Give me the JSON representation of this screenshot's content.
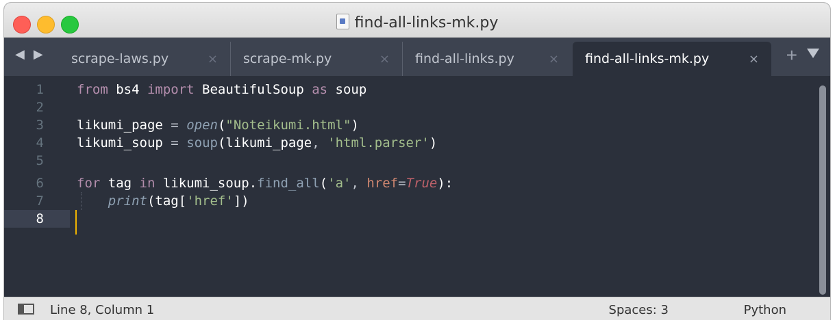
{
  "window": {
    "title": "find-all-links-mk.py"
  },
  "tabs": [
    {
      "label": "scrape-laws.py",
      "close": "×",
      "active": false
    },
    {
      "label": "scrape-mk.py",
      "close": "×",
      "active": false
    },
    {
      "label": "find-all-links.py",
      "close": "×",
      "active": false
    },
    {
      "label": "find-all-links-mk.py",
      "close": "×",
      "active": true
    }
  ],
  "tabbar": {
    "nav_arrows": "◀ ▶",
    "new_tab": "+"
  },
  "editor": {
    "line_numbers": [
      "1",
      "2",
      "3",
      "4",
      "5",
      "6",
      "7",
      "8"
    ],
    "current_line": "8",
    "lines": {
      "l1": {
        "t1": "from",
        "t2": " bs4 ",
        "t3": "import",
        "t4": " BeautifulSoup ",
        "t5": "as",
        "t6": " soup"
      },
      "l3": {
        "t1": "likumi_page ",
        "t2": "=",
        "t3": " ",
        "t4": "open",
        "t5": "(",
        "t6": "\"Noteikumi.html\"",
        "t7": ")"
      },
      "l4": {
        "t1": "likumi_soup ",
        "t2": "=",
        "t3": " ",
        "t4": "soup",
        "t5": "(likumi_page",
        "t6": ",",
        "t7": " ",
        "t8": "'html.parser'",
        "t9": ")"
      },
      "l6": {
        "t1": "for",
        "t2": " tag ",
        "t3": "in",
        "t4": " likumi_soup",
        "t5": ".",
        "t6": "find_all",
        "t7": "(",
        "t8": "'a'",
        "t9": ",",
        "t10": " ",
        "t11": "href",
        "t12": "=",
        "t13": "True",
        "t14": "):"
      },
      "l7": {
        "t0": "    ",
        "t1": "print",
        "t2": "(tag[",
        "t3": "'href'",
        "t4": "])"
      }
    }
  },
  "statusbar": {
    "position": "Line 8, Column 1",
    "indentation": "Spaces: 3",
    "syntax": "Python"
  },
  "colors": {
    "background": "#2b303b",
    "keyword": "#b48ead",
    "function": "#8fa1b3",
    "string": "#a3be8c",
    "parameter": "#d08770",
    "constant": "#bf616a",
    "cursor": "#f0b400"
  }
}
